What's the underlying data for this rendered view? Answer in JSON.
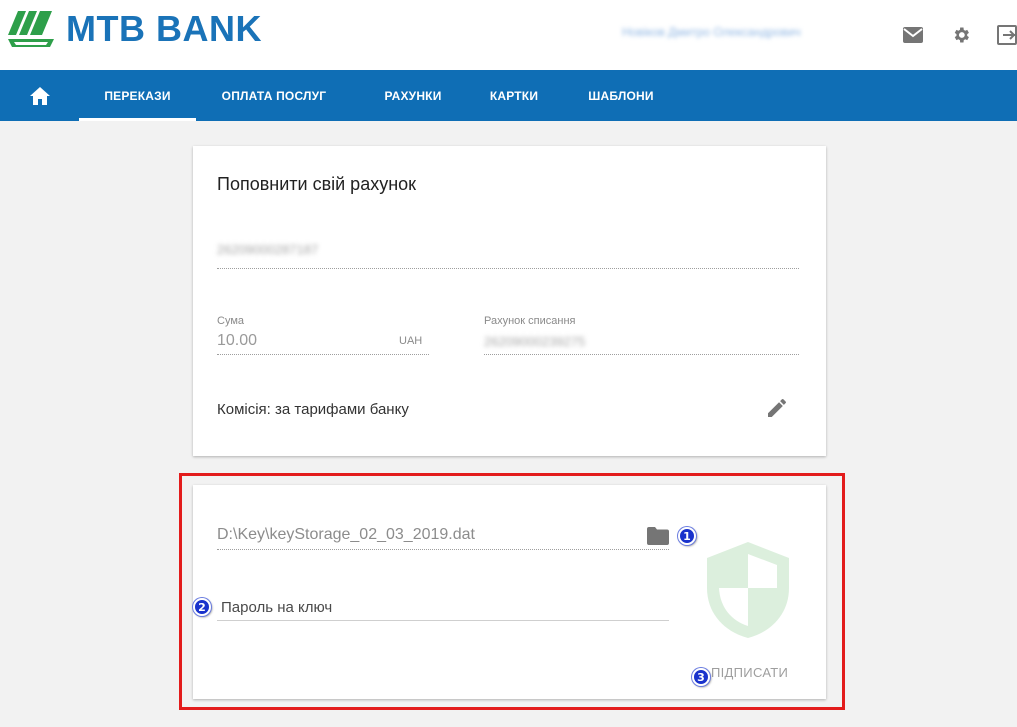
{
  "brand": {
    "name": "MTB BANK",
    "color": "#1a73b8",
    "logo_colors": [
      "#2e9f4a",
      "#1a73b8"
    ]
  },
  "header": {
    "user_name": "Новіков Дмитро Олександрович",
    "icons": [
      "mail-icon",
      "gear-icon",
      "logout-icon"
    ]
  },
  "nav": {
    "background": "#0f6eb5",
    "home_icon": "home-icon",
    "items": [
      {
        "label": "ПЕРЕКАЗИ",
        "active": true
      },
      {
        "label": "ОПЛАТА ПОСЛУГ",
        "active": false
      },
      {
        "label": "РАХУНКИ",
        "active": false
      },
      {
        "label": "КАРТКИ",
        "active": false
      },
      {
        "label": "ШАБЛОНИ",
        "active": false
      }
    ]
  },
  "transfer_card": {
    "title": "Поповнити свій рахунок",
    "target_account": "26209000287187",
    "amount_label": "Сума",
    "amount_value": "10.00",
    "currency": "UAH",
    "debit_account_label": "Рахунок списання",
    "debit_account_value": "26209000239275",
    "commission": "Комісія: за тарифами банку",
    "edit_icon": "pencil-icon"
  },
  "sign_card": {
    "key_file_path": "D:\\Key\\keyStorage_02_03_2019.dat",
    "folder_icon": "folder-icon",
    "password_placeholder": "Пароль на ключ",
    "shield_icon": "shield-icon",
    "shield_color": "#dff0e0",
    "sign_button": "ПІДПИСАТИ"
  },
  "annotations": {
    "highlight_color": "#e31c1c",
    "marker_color": "#1a33cc",
    "markers": [
      "1",
      "2",
      "3"
    ]
  }
}
